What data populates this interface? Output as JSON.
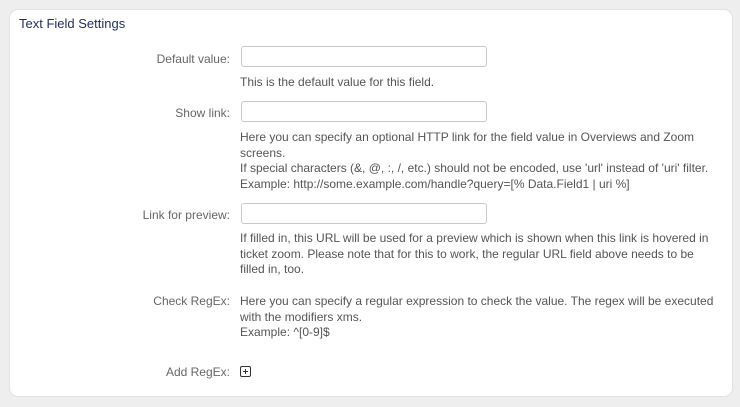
{
  "section": {
    "title": "Text Field Settings"
  },
  "default_value": {
    "label": "Default value:",
    "value": "",
    "help": "This is the default value for this field."
  },
  "show_link": {
    "label": "Show link:",
    "value": "",
    "help_lines": [
      "Here you can specify an optional HTTP link for the field value in Overviews and Zoom screens.",
      "If special characters (&, @, :, /, etc.) should not be encoded, use 'url' instead of 'uri' filter.",
      "Example: http://some.example.com/handle?query=[% Data.Field1 | uri %]"
    ]
  },
  "link_preview": {
    "label": "Link for preview:",
    "value": "",
    "help": "If filled in, this URL will be used for a preview which is shown when this link is hovered in ticket zoom. Please note that for this to work, the regular URL field above needs to be filled in, too."
  },
  "check_regex": {
    "label": "Check RegEx:",
    "help_lines": [
      "Here you can specify a regular expression to check the value. The regex will be executed with the modifiers xms.",
      "Example: ^[0-9]$"
    ]
  },
  "add_regex": {
    "label": "Add RegEx:",
    "icon": "plus-square-icon"
  }
}
